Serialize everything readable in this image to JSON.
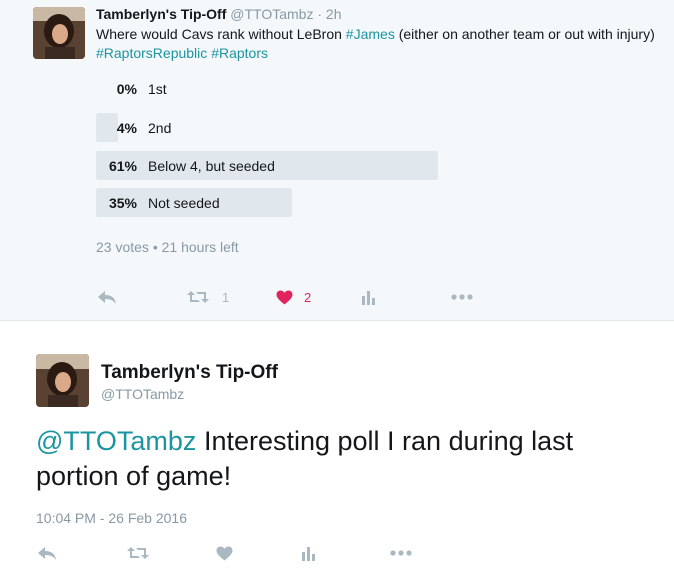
{
  "quoted_tweet": {
    "author_name": "Tamberlyn's Tip-Off",
    "handle": "@TTOTambz",
    "separator": "·",
    "time_ago": "2h",
    "text_parts": {
      "prefix": "Where would Cavs rank without LeBron ",
      "hashtag1": "#James",
      "middle": " (either on another team or out with injury) ",
      "hashtag2": "#RaptorsRepublic",
      "space": " ",
      "hashtag3": "#Raptors"
    },
    "poll": {
      "options": [
        {
          "percent_label": "0%",
          "label": "1st",
          "fraction": 0.0
        },
        {
          "percent_label": "4%",
          "label": "2nd",
          "fraction": 0.04
        },
        {
          "percent_label": "61%",
          "label": "Below 4, but seeded",
          "fraction": 0.61
        },
        {
          "percent_label": "35%",
          "label": "Not seeded",
          "fraction": 0.35
        }
      ],
      "votes": "23 votes",
      "bullet": "•",
      "time_left": "21 hours left"
    },
    "actions": {
      "retweet_count": "1",
      "like_count": "2",
      "liked": true
    }
  },
  "main_tweet": {
    "author_name": "Tamberlyn's Tip-Off",
    "handle": "@TTOTambz",
    "mention": "@TTOTambz",
    "text": " Interesting poll I ran during last portion of game!",
    "timestamp": "10:04 PM - 26 Feb 2016"
  },
  "icons": {
    "reply": "reply-icon",
    "retweet": "retweet-icon",
    "like": "heart-icon",
    "analytics": "analytics-icon",
    "more": "more-icon"
  },
  "colors": {
    "link": "#1b95a0",
    "muted": "#8899a6",
    "icon": "#aab8c2",
    "like_active": "#e0245e",
    "poll_bar": "#e1e8ed",
    "quoted_bg": "#f5f8fa"
  }
}
